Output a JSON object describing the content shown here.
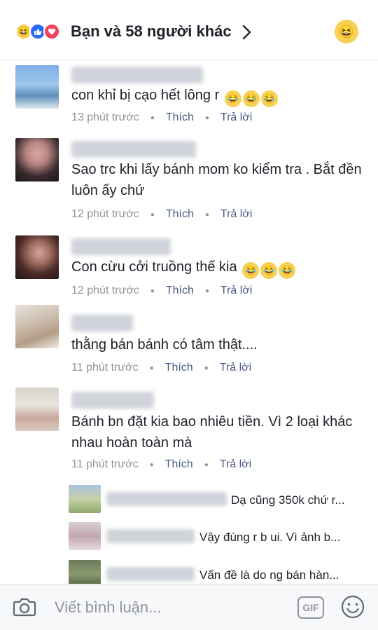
{
  "header": {
    "title": "Bạn và 58 người khác",
    "chevron": "›",
    "reaction_icons": [
      "haha-icon",
      "like-icon",
      "love-icon"
    ]
  },
  "comments": [
    {
      "text": "con khỉ bị cạo hết lông r",
      "emoji_count": 3,
      "time": "13 phút trước",
      "like": "Thích",
      "reply": "Trả lời"
    },
    {
      "text": "Sao trc khi lấy bánh mom ko kiểm tra . Bắt đền luôn ấy chứ",
      "emoji_count": 0,
      "time": "12 phút trước",
      "like": "Thích",
      "reply": "Trả lời"
    },
    {
      "text": "Con cừu cởi truồng thế kia",
      "emoji_count": 3,
      "time": "12 phút trước",
      "like": "Thích",
      "reply": "Trả lời"
    },
    {
      "text": "thằng bán bánh có tâm thật....",
      "emoji_count": 0,
      "time": "11 phút trước",
      "like": "Thích",
      "reply": "Trả lời"
    },
    {
      "text": "Bánh bn đặt kia bao nhiêu tiền. Vì 2 loại khác nhau hoàn toàn mà",
      "emoji_count": 0,
      "time": "11 phút trước",
      "like": "Thích",
      "reply": "Trả lời"
    }
  ],
  "replies": [
    {
      "text": "Dạ cũng 350k chứ r..."
    },
    {
      "text": "Vậy đúng r b ui. Vì ảnh b..."
    },
    {
      "text": "Vấn đề là do ng bán hàn..."
    }
  ],
  "composer": {
    "placeholder": "Viết bình luận...",
    "gif_label": "GIF"
  },
  "colors": {
    "action": "#4b5b86",
    "meta": "#90949c",
    "text": "#1d2129"
  }
}
